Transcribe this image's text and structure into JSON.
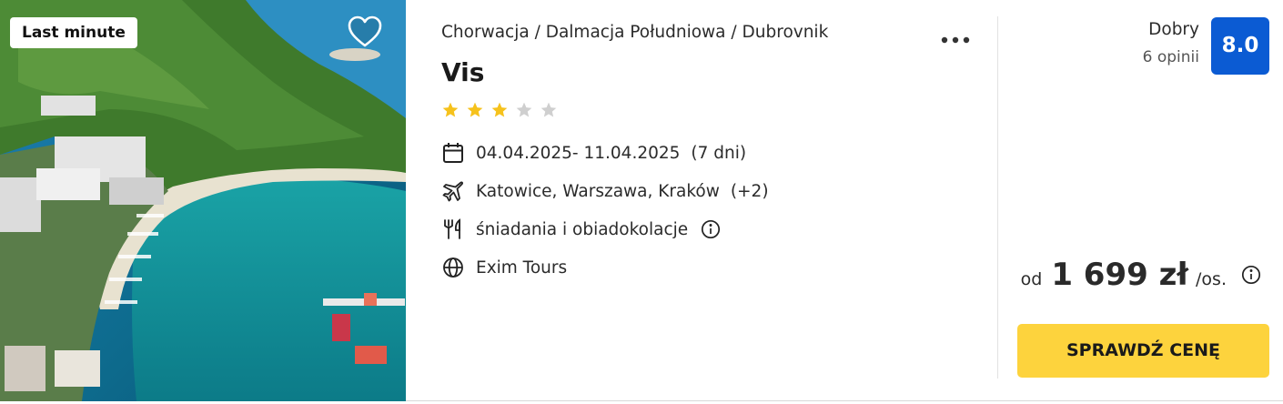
{
  "offer": {
    "badge": "Last minute",
    "breadcrumb": [
      "Chorwacja",
      "Dalmacja Południowa",
      "Dubrovnik"
    ],
    "breadcrumb_separator": "/",
    "title": "Vis",
    "stars": {
      "filled": 3,
      "total": 5,
      "filled_color": "#f6c21c",
      "empty_color": "#cfcfcf"
    },
    "dates": "04.04.2025- 11.04.2025",
    "duration": "(7 dni)",
    "departures": "Katowice, Warszawa, Kraków",
    "departures_extra": "(+2)",
    "board": "śniadania i obiadokolacje",
    "operator": "Exim Tours",
    "icons": {
      "favorite": "heart-icon",
      "menu": "more-dots-icon",
      "dates": "calendar-icon",
      "departures": "plane-icon",
      "board": "cutlery-icon",
      "board_info": "info-icon",
      "operator": "globe-icon"
    }
  },
  "rating": {
    "label": "Dobry",
    "count": "6 opinii",
    "score": "8.0",
    "score_color": "#0b5bd3"
  },
  "price": {
    "prefix": "od",
    "value": "1 699 zł",
    "suffix": "/os.",
    "cta": "SPRAWDŹ CENĘ",
    "cta_color": "#fdd33d"
  }
}
